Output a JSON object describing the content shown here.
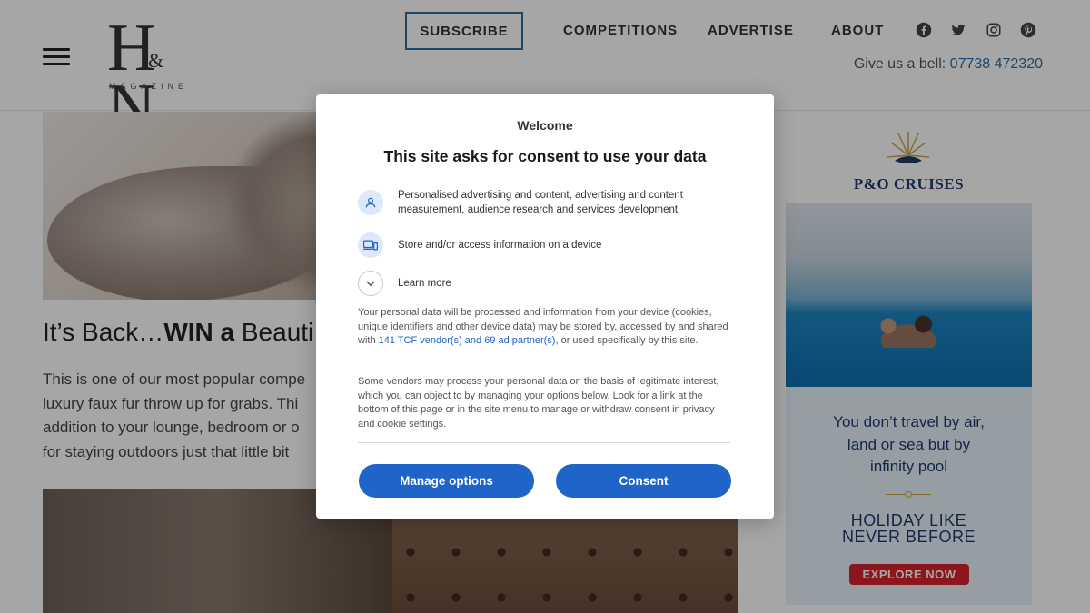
{
  "header": {
    "logo_text": "H&N",
    "logo_subtitle": "MAGAZINE",
    "nav": {
      "subscribe": "SUBSCRIBE",
      "competitions": "COMPETITIONS",
      "advertise": "ADVERTISE",
      "about": "ABOUT"
    },
    "social_icons": [
      "facebook-icon",
      "twitter-icon",
      "instagram-icon",
      "pinterest-icon"
    ],
    "phone_label": "Give us a bell:",
    "phone_number": "07738 472320"
  },
  "article": {
    "title_prefix": "It’s Back…",
    "title_bold": "WIN a",
    "title_suffix": " Beauti",
    "body_lines": [
      "This is one of our most popular compe",
      "luxury faux fur throw up for grabs. Thi",
      "addition to your lounge, bedroom or o",
      "for staying outdoors just that little bit"
    ]
  },
  "advert": {
    "brand": "P&O CRUISES",
    "tagline_lines": [
      "You don’t travel by air,",
      "land or sea but by",
      "infinity pool"
    ],
    "headline_lines": [
      "HOLIDAY LIKE",
      "NEVER BEFORE"
    ],
    "cta": "EXPLORE NOW"
  },
  "consent": {
    "welcome": "Welcome",
    "title": "This site asks for consent to use your data",
    "purposes": [
      {
        "icon": "person-icon",
        "lines": [
          "Personalised advertising and content, advertising and content",
          "measurement, audience research and services development"
        ]
      },
      {
        "icon": "devices-icon",
        "lines": [
          "Store and/or access information on a device"
        ]
      }
    ],
    "learn_more": "Learn more",
    "para1_before": "Your personal data will be processed and information from your device (cookies, unique identifiers and other device data) may be stored by, accessed by and shared with ",
    "para1_link": "141 TCF vendor(s) and 69 ad partner(s)",
    "para1_after": ", or used specifically by this site.",
    "para2": "Some vendors may process your personal data on the basis of legitimate interest, which you can object to by managing your options below. Look for a link at the bottom of this page or in the site menu to manage or withdraw consent in privacy and cookie settings.",
    "manage_button": "Manage options",
    "consent_button": "Consent"
  },
  "colors": {
    "accent_blue": "#1f64c8",
    "nav_border": "#2d6ea3",
    "ad_navy": "#1f3a6b",
    "ad_red": "#d7222c"
  }
}
